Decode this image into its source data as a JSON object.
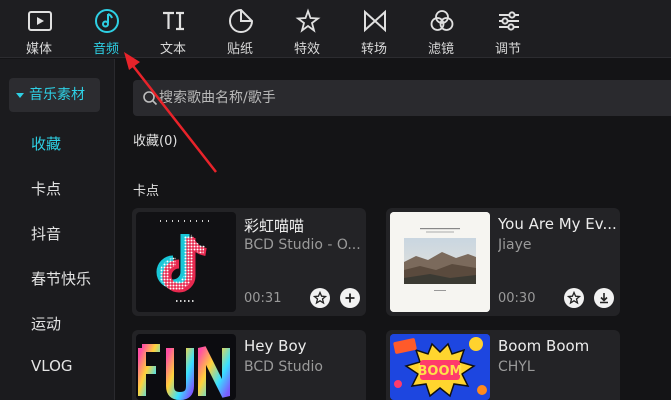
{
  "toolbar": {
    "tabs": [
      {
        "label": "媒体",
        "icon": "media-play-icon",
        "active": false
      },
      {
        "label": "音频",
        "icon": "music-note-icon",
        "active": true
      },
      {
        "label": "文本",
        "icon": "text-ti-icon",
        "active": false
      },
      {
        "label": "贴纸",
        "icon": "sticker-icon",
        "active": false
      },
      {
        "label": "特效",
        "icon": "effects-star-icon",
        "active": false
      },
      {
        "label": "转场",
        "icon": "transition-bowtie-icon",
        "active": false
      },
      {
        "label": "滤镜",
        "icon": "filter-circles-icon",
        "active": false
      },
      {
        "label": "调节",
        "icon": "adjust-sliders-icon",
        "active": false
      }
    ],
    "accent_color": "#2ed0e4"
  },
  "sidebar": {
    "header": "音乐素材",
    "items": [
      {
        "label": "收藏",
        "active": true
      },
      {
        "label": "卡点",
        "active": false
      },
      {
        "label": "抖音",
        "active": false
      },
      {
        "label": "春节快乐",
        "active": false
      },
      {
        "label": "运动",
        "active": false
      },
      {
        "label": "VLOG",
        "active": false
      }
    ]
  },
  "search": {
    "placeholder": "搜索歌曲名称/歌手"
  },
  "sections": {
    "favorites": "收藏(0)",
    "beats": "卡点"
  },
  "cards": [
    {
      "title": "彩虹喵喵",
      "artist": "BCD Studio - O...",
      "duration": "00:31",
      "action": "add",
      "thumb": "tiktok-logo"
    },
    {
      "title": "You Are My Ev...",
      "artist": "Jiaye",
      "duration": "00:30",
      "action": "download",
      "thumb": "landscape-photo"
    },
    {
      "title": "Hey Boy",
      "artist": "BCD Studio",
      "duration": "",
      "action": "",
      "thumb": "fun-text"
    },
    {
      "title": "Boom Boom",
      "artist": "CHYL",
      "duration": "",
      "action": "",
      "thumb": "boom-comic"
    }
  ],
  "annotation": {
    "arrow_color": "#e8232a"
  }
}
